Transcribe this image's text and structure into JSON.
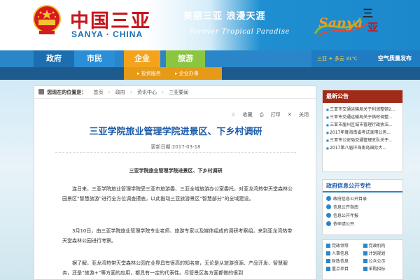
{
  "header": {
    "logo_cn": "中国三亚",
    "logo_en": "SANYA · CHINA",
    "slogan_cn": "美丽三亚 浪漫天涯",
    "slogan_en": "Forever Tropical Paradise",
    "brand_en": "Sanya",
    "brand_cn_top": "三",
    "brand_cn_bottom": "亚"
  },
  "nav": {
    "items": [
      "政府",
      "市民",
      "企业",
      "旅游"
    ],
    "weather": "三亚 ☀ 多云 31℃",
    "aqi": "空气质量发布"
  },
  "subnav": {
    "items": [
      "投资服务",
      "企业办事"
    ]
  },
  "breadcrumb": {
    "label": "您现在的位置是：",
    "items": [
      "首页",
      "政府",
      "资讯中心",
      "三亚要闻"
    ]
  },
  "tools": {
    "favorite": "收藏",
    "print": "打印",
    "close": "关闭"
  },
  "article": {
    "title": "三亚学院旅业管理学院进景区、下乡村调研",
    "date": "更新日期:2017-03-18",
    "subhead": "三亚学院旅业管理学院进景区、下乡村调研",
    "paragraphs": [
      "连日来，三亚学院旅业管理学院受三亚市旅游委、三亚全域旅游办公室委托，对亚龙湾热带天堂森林公园景区“智慧旅游”进行全方位调查摸底，以此推动三亚旅游景区“智慧部分”的全域建设。",
      "3月10日，由三亚学院旅业管理学院专业老师、旅游专家以及媒体组成的调研考察组，来到亚龙湾热带天堂森林公园进行考察。",
      "据了解，亚龙湾热带天堂森林公园在业界具有很高的知名度，无论是从旅游资源、产品开发、智慧服务，还是“旅游+”等方面的应用，都具有一定的代表性。尽管景区各方面都做的很到"
    ]
  },
  "sidebar": {
    "notice": {
      "title": "最新公告",
      "items": [
        "三亚市交通运输局关于利润整顿2...",
        "三亚市交通运输局关于临时调整...",
        "三亚市崖州区城市管理行政执法...",
        "2017年度海南省考试录用公务...",
        "三亚市公安局交通管理支队关于...",
        "2017第八届环海南岛国际大..."
      ]
    },
    "info": {
      "title": "政府信息公开专栏",
      "items": [
        "政府信息公开目录",
        "信息公开指南",
        "信息公开年报",
        "依申请公开"
      ]
    },
    "links": {
      "items": [
        "党政领导",
        "党政机构",
        "人事信息",
        "计划规划",
        "财政信息",
        "公众公示",
        "重点项目",
        "采购招标"
      ]
    }
  },
  "colors": {
    "nav_blue": "#2a86c9",
    "enterprise_orange": "#f4a41c",
    "tourism_green": "#8cc540",
    "title_blue": "#1b5aa8",
    "notice_red": "#a12b19"
  }
}
